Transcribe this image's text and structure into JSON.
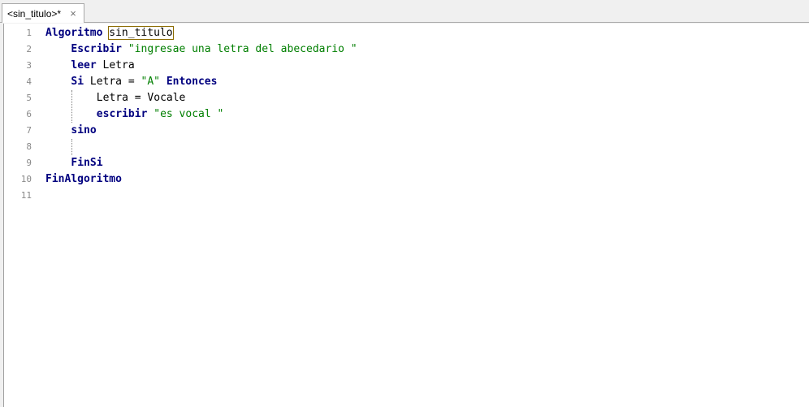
{
  "tab": {
    "title": "<sin_titulo>*",
    "close_glyph": "×"
  },
  "lines": [
    {
      "n": "1",
      "indent": 0,
      "tokens": [
        {
          "t": "kw",
          "v": "Algoritmo"
        },
        {
          "t": "sp",
          "v": " "
        },
        {
          "t": "idhl",
          "v": "sin_titulo"
        }
      ]
    },
    {
      "n": "2",
      "indent": 1,
      "tokens": [
        {
          "t": "kw",
          "v": "Escribir"
        },
        {
          "t": "sp",
          "v": " "
        },
        {
          "t": "str",
          "v": "\"ingresae una letra del abecedario \""
        }
      ]
    },
    {
      "n": "3",
      "indent": 1,
      "tokens": [
        {
          "t": "kw",
          "v": "leer"
        },
        {
          "t": "sp",
          "v": " "
        },
        {
          "t": "id",
          "v": "Letra"
        }
      ]
    },
    {
      "n": "4",
      "indent": 1,
      "tokens": [
        {
          "t": "kw",
          "v": "Si"
        },
        {
          "t": "sp",
          "v": " "
        },
        {
          "t": "id",
          "v": "Letra = "
        },
        {
          "t": "str",
          "v": "\"A\""
        },
        {
          "t": "sp",
          "v": " "
        },
        {
          "t": "kw",
          "v": "Entonces"
        }
      ]
    },
    {
      "n": "5",
      "indent": 2,
      "tokens": [
        {
          "t": "id",
          "v": "Letra = Vocale"
        }
      ]
    },
    {
      "n": "6",
      "indent": 2,
      "tokens": [
        {
          "t": "kw",
          "v": "escribir"
        },
        {
          "t": "sp",
          "v": " "
        },
        {
          "t": "str",
          "v": "\"es vocal \""
        }
      ]
    },
    {
      "n": "7",
      "indent": 1,
      "tokens": [
        {
          "t": "kw",
          "v": "sino"
        }
      ]
    },
    {
      "n": "8",
      "indent": 1,
      "tokens": []
    },
    {
      "n": "9",
      "indent": 1,
      "tokens": [
        {
          "t": "kw",
          "v": "FinSi"
        }
      ]
    },
    {
      "n": "10",
      "indent": 0,
      "tokens": [
        {
          "t": "kw",
          "v": "FinAlgoritmo"
        }
      ]
    },
    {
      "n": "11",
      "indent": 0,
      "tokens": []
    }
  ],
  "colors": {
    "keyword": "#00007f",
    "string": "#007f00",
    "line_number": "#8a8a8a",
    "highlight_box": "#8b6b00"
  }
}
